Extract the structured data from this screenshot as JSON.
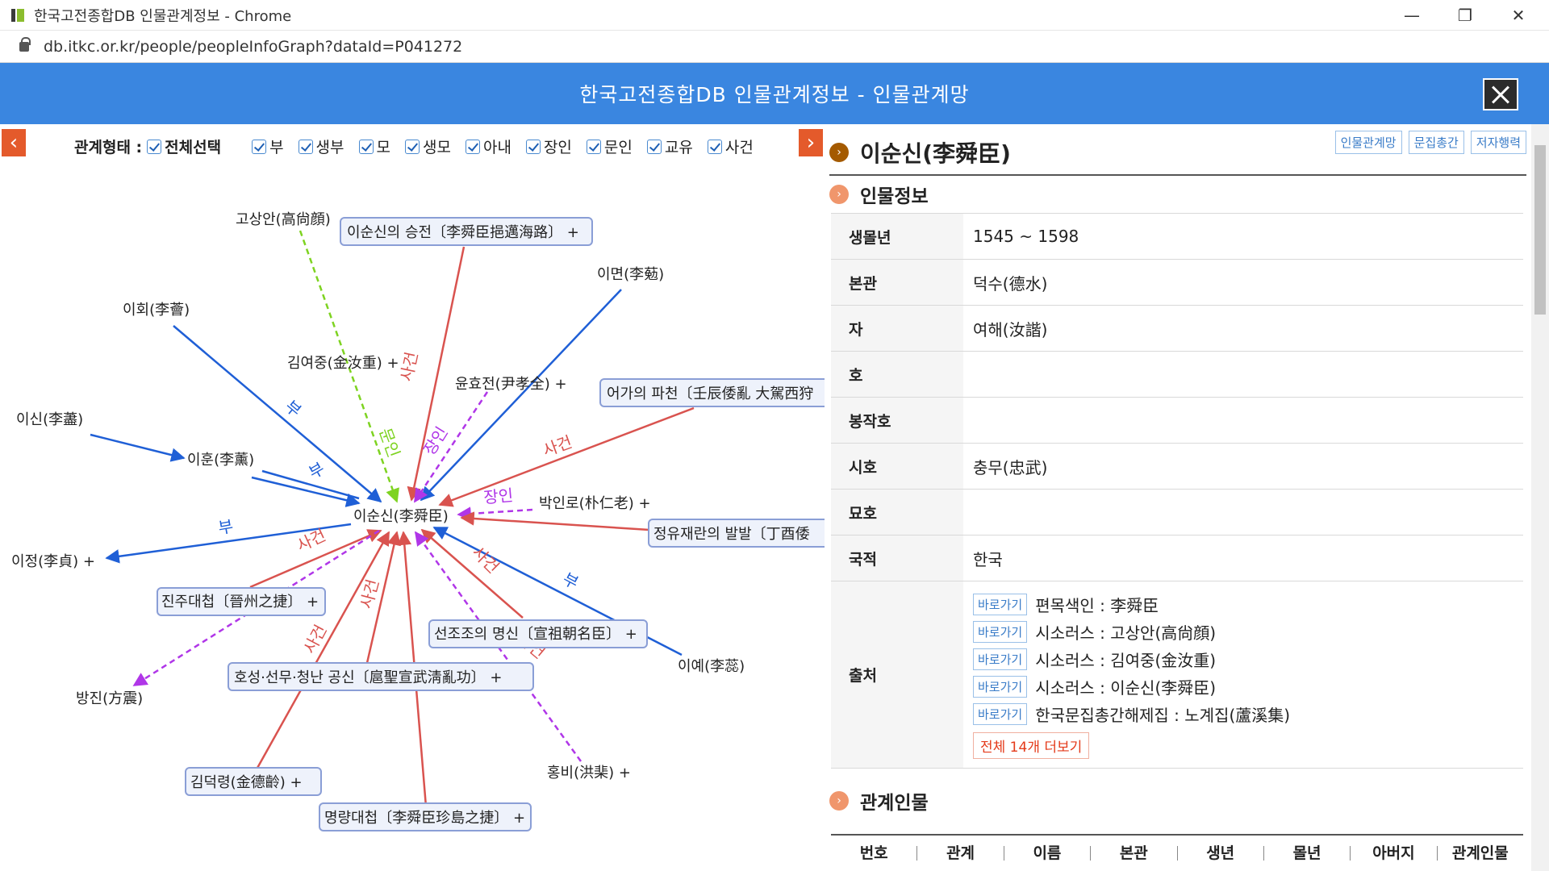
{
  "window": {
    "title": "한국고전종합DB 인물관계정보 - Chrome",
    "url": "db.itkc.or.kr/people/peopleInfoGraph?dataId=P041272"
  },
  "header": {
    "title": "한국고전종합DB 인물관계정보 - 인물관계망"
  },
  "filter": {
    "label": "관계형태 :",
    "items": [
      "전체선택",
      "부",
      "생부",
      "모",
      "생모",
      "아내",
      "장인",
      "문인",
      "교유",
      "사건"
    ]
  },
  "graph": {
    "center": "이순신(李舜臣)",
    "nodes": [
      "고상안(高尙顔)",
      "이순신의 승전〔李舜臣挹邁海路〕 +",
      "이면(李葂)",
      "이회(李薈)",
      "김여중(金汝重) +",
      "윤효전(尹孝全) +",
      "어가의 파천〔壬辰倭亂 大駕西狩",
      "이신(李藎)",
      "이훈(李薰)",
      "박인로(朴仁老) +",
      "정유재란의 발발〔丁酉倭",
      "이정(李貞) +",
      "진주대첩〔晉州之捷〕 +",
      "선조조의 명신〔宣祖朝名臣〕 +",
      "이예(李蕊)",
      "방진(方震)",
      "호성·선무·청난 공신〔扈聖宣武淸亂功〕 +",
      "홍비(洪棐) +",
      "김덕령(金德齡) +",
      "명량대첩〔李舜臣珍島之捷〕 +"
    ],
    "edge_labels": [
      "부",
      "부",
      "부",
      "부",
      "문인",
      "장인",
      "장인",
      "사건",
      "사건",
      "사건",
      "사건",
      "사건",
      "사건",
      "사건"
    ]
  },
  "person": {
    "name": "이순신(李舜臣)",
    "tabs": [
      "인물관계망",
      "문집총간",
      "저자행력"
    ]
  },
  "info": {
    "section_title": "인물정보",
    "rows": [
      {
        "key": "생몰년",
        "value": "1545 ~ 1598"
      },
      {
        "key": "본관",
        "value": "덕수(德水)"
      },
      {
        "key": "자",
        "value": "여해(汝諧)"
      },
      {
        "key": "호",
        "value": ""
      },
      {
        "key": "봉작호",
        "value": ""
      },
      {
        "key": "시호",
        "value": "충무(忠武)"
      },
      {
        "key": "묘호",
        "value": ""
      },
      {
        "key": "국적",
        "value": "한국"
      }
    ],
    "source_key": "출처",
    "source_button": "바로가기",
    "sources": [
      "편목색인 : 李舜臣",
      "시소러스 : 고상안(高尙顔)",
      "시소러스 : 김여중(金汝重)",
      "시소러스 : 이순신(李舜臣)",
      "한국문집총간해제집 : 노계집(蘆溪集)"
    ],
    "more": "전체 14개 더보기"
  },
  "relations": {
    "section_title": "관계인물",
    "columns": [
      "번호",
      "관계",
      "이름",
      "본관",
      "생년",
      "몰년",
      "아버지",
      "관계인물"
    ]
  },
  "colors": {
    "header": "#3a86e0",
    "father": "#1f5fd6",
    "event": "#d9534f",
    "disciple": "#7ed321",
    "inlaw": "#b036e8"
  }
}
